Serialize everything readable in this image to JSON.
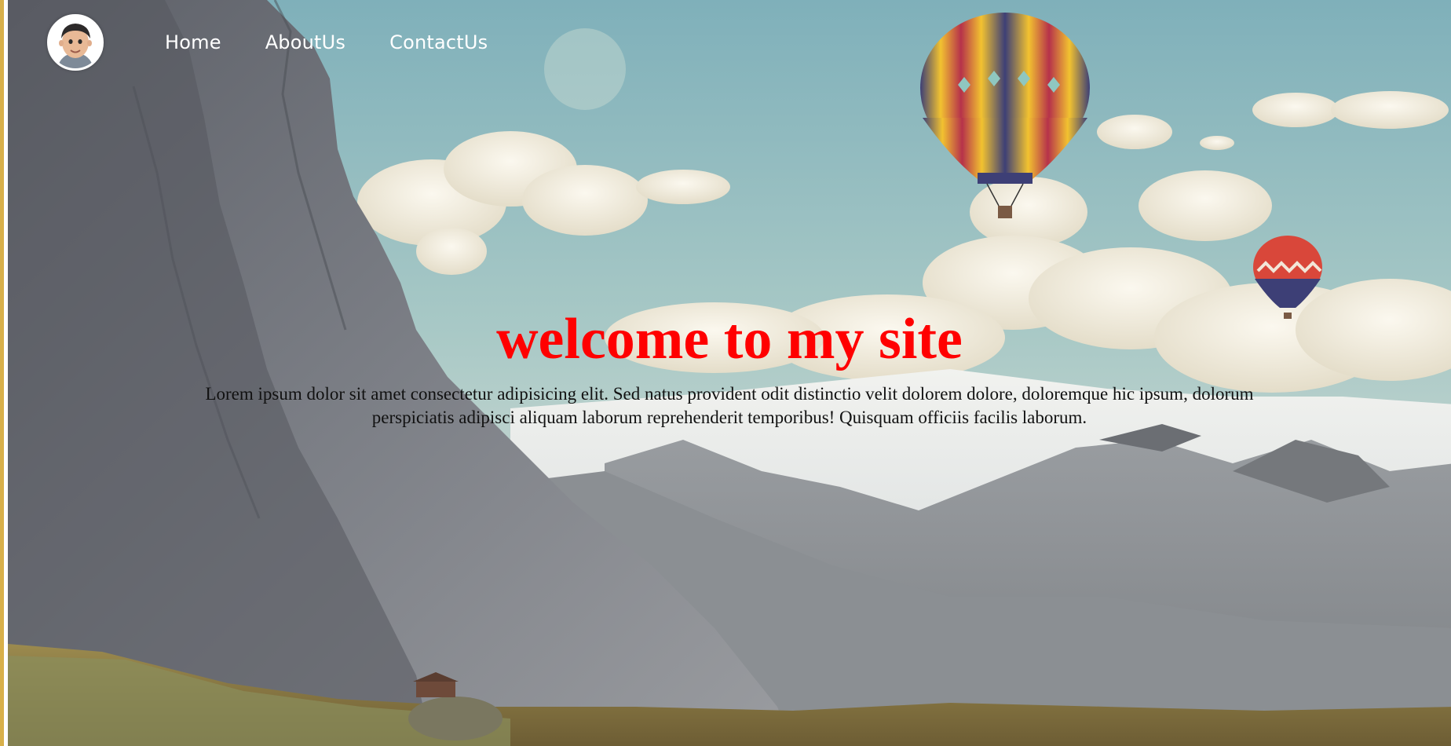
{
  "nav": {
    "links": [
      {
        "label": "Home"
      },
      {
        "label": "AboutUs"
      },
      {
        "label": "ContactUs"
      }
    ]
  },
  "hero": {
    "title": "welcome to my site",
    "text": "Lorem ipsum dolor sit amet consectetur adipisicing elit. Sed natus provident odit distinctio velit dolorem dolore, doloremque hic ipsum, dolorum perspiciatis adipisci aliquam laborum reprehenderit temporibus! Quisquam officiis facilis laborum."
  },
  "colors": {
    "title": "#ff0000",
    "nav_text": "#ffffff",
    "page_border": "#d8b04a"
  }
}
